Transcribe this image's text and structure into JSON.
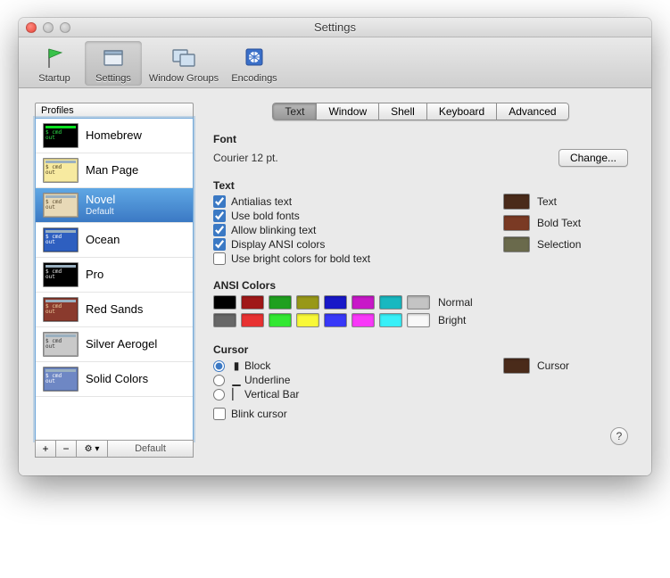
{
  "window": {
    "title": "Settings"
  },
  "toolbar": {
    "items": [
      {
        "label": "Startup"
      },
      {
        "label": "Settings"
      },
      {
        "label": "Window Groups"
      },
      {
        "label": "Encodings"
      }
    ]
  },
  "sidebar": {
    "header": "Profiles",
    "profiles": [
      {
        "name": "Homebrew",
        "bg": "#000000",
        "fg": "#2fe24a"
      },
      {
        "name": "Man Page",
        "bg": "#f7eaa0",
        "fg": "#4a3d1f"
      },
      {
        "name": "Novel",
        "subtitle": "Default",
        "bg": "#e8d9b7",
        "fg": "#5a4a2c",
        "selected": true
      },
      {
        "name": "Ocean",
        "bg": "#2e5fc0",
        "fg": "#ffffff"
      },
      {
        "name": "Pro",
        "bg": "#000000",
        "fg": "#e8e8e8"
      },
      {
        "name": "Red Sands",
        "bg": "#8a3a2d",
        "fg": "#f0d0a0"
      },
      {
        "name": "Silver Aerogel",
        "bg": "#c9c9c9",
        "fg": "#333333"
      },
      {
        "name": "Solid Colors",
        "bg": "#6e87c4",
        "fg": "#ffffff"
      }
    ],
    "buttons": {
      "add": "+",
      "remove": "−",
      "gear": "⚙",
      "gearext": "▾",
      "default": "Default"
    }
  },
  "tabs": [
    "Text",
    "Window",
    "Shell",
    "Keyboard",
    "Advanced"
  ],
  "font": {
    "header": "Font",
    "description": "Courier 12 pt.",
    "change": "Change..."
  },
  "text": {
    "header": "Text",
    "options": [
      {
        "label": "Antialias text",
        "checked": true
      },
      {
        "label": "Use bold fonts",
        "checked": true
      },
      {
        "label": "Allow blinking text",
        "checked": true
      },
      {
        "label": "Display ANSI colors",
        "checked": true
      },
      {
        "label": "Use bright colors for bold text",
        "checked": false
      }
    ],
    "wells": [
      {
        "label": "Text",
        "color": "#4a2b1a"
      },
      {
        "label": "Bold Text",
        "color": "#7a3a24"
      },
      {
        "label": "Selection",
        "color": "#6a6a4c"
      }
    ]
  },
  "ansi": {
    "header": "ANSI Colors",
    "normal_label": "Normal",
    "bright_label": "Bright",
    "normal": [
      "#000000",
      "#a01818",
      "#1fa01f",
      "#989818",
      "#1818c8",
      "#c818c8",
      "#18b8c0",
      "#c4c4c4"
    ],
    "bright": [
      "#686868",
      "#e83232",
      "#32e832",
      "#f8f838",
      "#3838f8",
      "#f838f8",
      "#38f0f8",
      "#f8f8f8"
    ]
  },
  "cursor": {
    "header": "Cursor",
    "options": [
      {
        "label": "Block",
        "selected": true
      },
      {
        "label": "Underline",
        "selected": false
      },
      {
        "label": "Vertical Bar",
        "selected": false
      }
    ],
    "blink": {
      "label": "Blink cursor",
      "checked": false
    },
    "well": {
      "label": "Cursor",
      "color": "#4a2b1a"
    }
  },
  "help": "?"
}
